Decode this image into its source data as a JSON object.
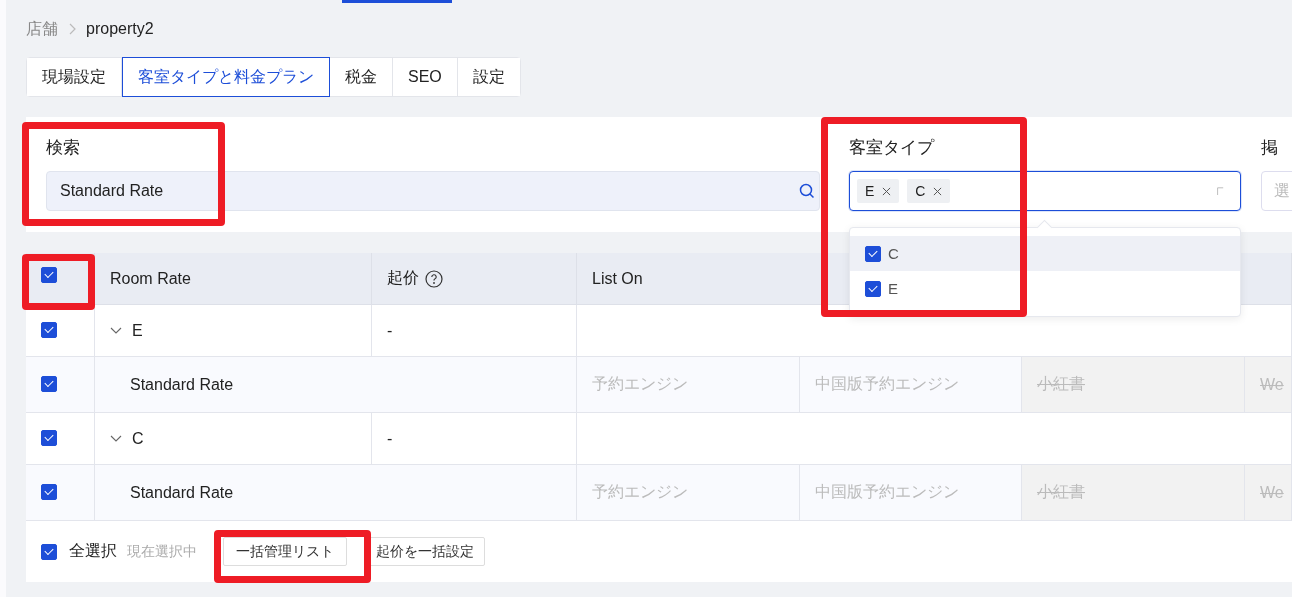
{
  "breadcrumb": [
    {
      "label": "店舗",
      "current": false
    },
    {
      "label": "property2",
      "current": true
    }
  ],
  "tabs": [
    {
      "label": "現場設定",
      "selected": false
    },
    {
      "label": "客室タイプと料金プラン",
      "selected": true
    },
    {
      "label": "税金",
      "selected": false
    },
    {
      "label": "SEO",
      "selected": false
    },
    {
      "label": "設定",
      "selected": false
    }
  ],
  "filters": {
    "search": {
      "label": "検索",
      "value": "Standard Rate"
    },
    "room_type": {
      "label": "客室タイプ",
      "tags": [
        "E",
        "C"
      ],
      "open": true,
      "options": [
        {
          "label": "C",
          "checked": true,
          "hovered": true
        },
        {
          "label": "E",
          "checked": true,
          "hovered": false
        }
      ]
    },
    "listing": {
      "label": "掲",
      "placeholder": "選"
    }
  },
  "table": {
    "header_checked": true,
    "columns": [
      {
        "label": "Room Rate",
        "help": false
      },
      {
        "label": "起价",
        "help": true
      },
      {
        "label": "List On",
        "help": false
      }
    ],
    "groups": [
      {
        "name": "E",
        "checked": true,
        "expanded": true,
        "start_price": "-",
        "rates": [
          {
            "name": "Standard Rate",
            "checked": true,
            "channels": [
              {
                "label": "予約エンジン",
                "disabled": false
              },
              {
                "label": "中国版予約エンジン",
                "disabled": false
              },
              {
                "label": "小紅書",
                "disabled": true
              },
              {
                "label": "We",
                "disabled": true
              }
            ]
          }
        ]
      },
      {
        "name": "C",
        "checked": true,
        "expanded": true,
        "start_price": "-",
        "rates": [
          {
            "name": "Standard Rate",
            "checked": true,
            "channels": [
              {
                "label": "予約エンジン",
                "disabled": false
              },
              {
                "label": "中国版予約エンジン",
                "disabled": false
              },
              {
                "label": "小紅書",
                "disabled": true
              },
              {
                "label": "We",
                "disabled": true
              }
            ]
          }
        ]
      }
    ]
  },
  "footer": {
    "select_all": {
      "label": "全選択",
      "checked": true
    },
    "selection_info": "現在選択中",
    "buttons": [
      "一括管理リスト",
      "起价を一括設定"
    ]
  }
}
